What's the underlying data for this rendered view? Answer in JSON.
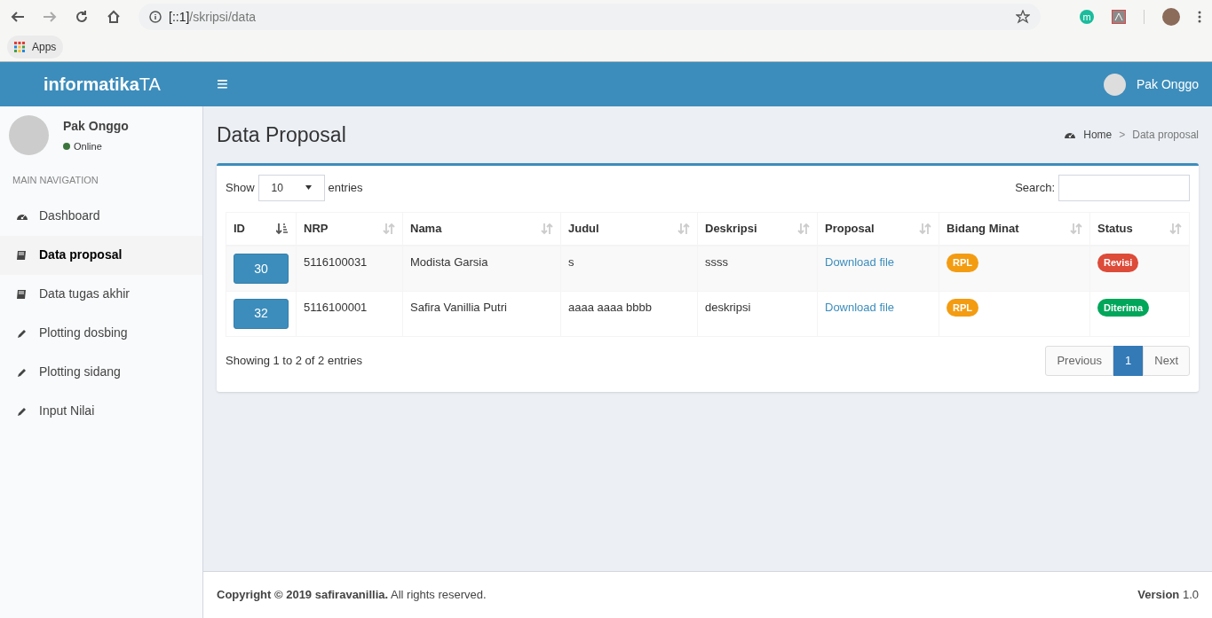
{
  "browser": {
    "url_host": "[::1]",
    "url_path": "/skripsi/data",
    "bookmarks": [
      "Apps"
    ],
    "extension_letter": "m"
  },
  "header": {
    "logo": "**informatika**TA",
    "menu_glyph": "≡",
    "user_name": "Pak Onggo"
  },
  "sidebar": {
    "user_name": "Pak Onggo",
    "status": "Online",
    "status_dot": {
      "color": "#3c763d"
    },
    "nav_header": "MAIN NAVIGATION",
    "items": [
      {
        "label": "Dashboard",
        "kind": "dashboard",
        "selected": false
      },
      {
        "label": "Data proposal",
        "kind": "book",
        "selected": true
      },
      {
        "label": "Data tugas akhir",
        "kind": "book",
        "selected": false
      },
      {
        "label": "Plotting dosbing",
        "kind": "pencil",
        "selected": false
      },
      {
        "label": "Plotting sidang",
        "kind": "pencil",
        "selected": false
      },
      {
        "label": "Input Nilai",
        "kind": "pencil",
        "selected": false
      }
    ]
  },
  "content": {
    "title": "Data Proposal",
    "breadcrumb_separator": ">",
    "breadcrumb": [
      {
        "label": "Home",
        "kind": "dashboard"
      },
      {
        "label": "Data proposal",
        "kind": "plain"
      }
    ],
    "table": {
      "show_label": "Show",
      "length_value": "10",
      "entries_label": "entries",
      "search_label": "Search:",
      "columns": [
        {
          "label": "ID",
          "sorted": true
        },
        {
          "label": "NRP",
          "sorted": false
        },
        {
          "label": "Nama",
          "sorted": false
        },
        {
          "label": "Judul",
          "sorted": false
        },
        {
          "label": "Deskripsi",
          "sorted": false
        },
        {
          "label": "Proposal",
          "sorted": false
        },
        {
          "label": "Bidang Minat",
          "sorted": false
        },
        {
          "label": "Status",
          "sorted": false
        }
      ],
      "rows": [
        {
          "id": "30",
          "nrp": "5116100031",
          "nama": "Modista Garsia",
          "judul": "s",
          "deskripsi": "ssss",
          "proposal": "Download file",
          "bidang": {
            "label": "RPL",
            "color": "#f39c12"
          },
          "status": {
            "label": "Revisi",
            "color": "#dd4b39"
          }
        },
        {
          "id": "32",
          "nrp": "5116100001",
          "nama": "Safira Vanillia Putri",
          "judul": "aaaa aaaa bbbb",
          "deskripsi": "deskripsi",
          "proposal": "Download file",
          "bidang": {
            "label": "RPL",
            "color": "#f39c12"
          },
          "status": {
            "label": "Diterima",
            "color": "#00a65a"
          }
        }
      ],
      "info": "Showing 1 to 2 of 2 entries",
      "pagination": [
        {
          "label": "Previous",
          "selected": false
        },
        {
          "label": "1",
          "selected": true
        },
        {
          "label": "Next",
          "selected": false
        }
      ]
    }
  },
  "footer": {
    "copyright": "**Copyright © 2019 safiravanillia.** All rights reserved.",
    "version": "**Version** 1.0"
  }
}
